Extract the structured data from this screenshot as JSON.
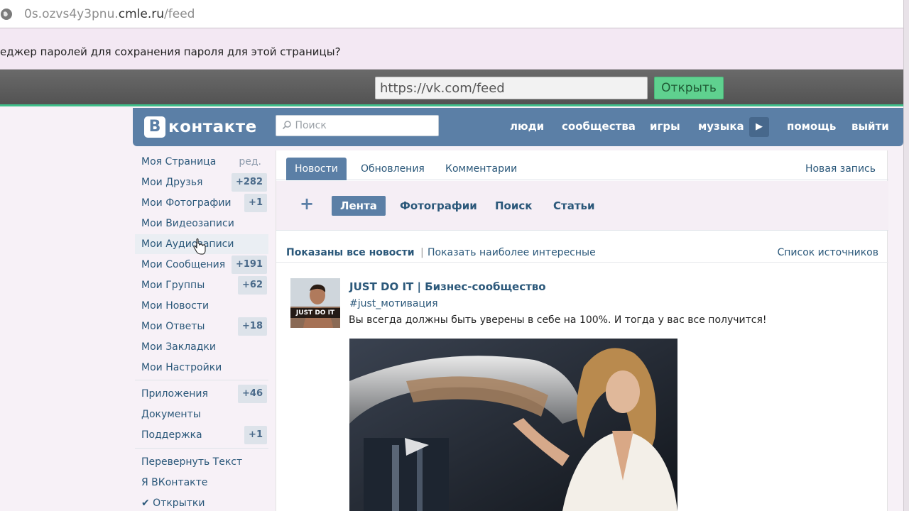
{
  "browser": {
    "url_prefix": "0s.ozvs4y3pnu.",
    "url_host": "cmle.ru",
    "url_path": "/feed"
  },
  "password_bar": {
    "message": "еджер паролей для сохранения пароля для этой страницы?"
  },
  "redirect_bar": {
    "url_value": "https://vk.com/feed",
    "open_button": "Открыть"
  },
  "header": {
    "logo_letter": "В",
    "logo_text": "контакте",
    "search_placeholder": "Поиск",
    "nav": [
      "люди",
      "сообщества",
      "игры",
      "музыка",
      "помощь",
      "выйти"
    ]
  },
  "menu": {
    "edit_label": "ред.",
    "items": [
      {
        "label": "Моя Страница",
        "count": ""
      },
      {
        "label": "Мои Друзья",
        "count": "+282"
      },
      {
        "label": "Мои Фотографии",
        "count": "+1"
      },
      {
        "label": "Мои Видеозаписи",
        "count": ""
      },
      {
        "label": "Мои Аудиозаписи",
        "count": ""
      },
      {
        "label": "Мои Сообщения",
        "count": "+191"
      },
      {
        "label": "Мои Группы",
        "count": "+62"
      },
      {
        "label": "Мои Новости",
        "count": ""
      },
      {
        "label": "Мои Ответы",
        "count": "+18"
      },
      {
        "label": "Мои Закладки",
        "count": ""
      },
      {
        "label": "Мои Настройки",
        "count": ""
      }
    ],
    "extra_items": [
      {
        "label": "Приложения",
        "count": "+46"
      },
      {
        "label": "Документы",
        "count": ""
      },
      {
        "label": "Поддержка",
        "count": "+1"
      }
    ],
    "bottom_items": [
      {
        "label": "Перевернуть Текст"
      },
      {
        "label": "Я ВКонтакте"
      },
      {
        "label": "✔ Открытки"
      }
    ]
  },
  "feed": {
    "tabs": [
      "Новости",
      "Обновления",
      "Комментарии"
    ],
    "new_post": "Новая запись",
    "plus": "+",
    "subtabs": [
      "Лента",
      "Фотографии",
      "Поиск",
      "Статьи"
    ],
    "filter_all": "Показаны все новости",
    "filter_sep": "|",
    "filter_interesting": "Показать наиболее интересные",
    "sources": "Список источников"
  },
  "post": {
    "author": "JUST DO IT | Бизнес-сообщество",
    "hashtag": "#just_мотивация",
    "text": "Вы всегда должны быть уверены в себе на 100%. И тогда у вас все получится!",
    "avatar_caption": "JUST DO IT"
  }
}
